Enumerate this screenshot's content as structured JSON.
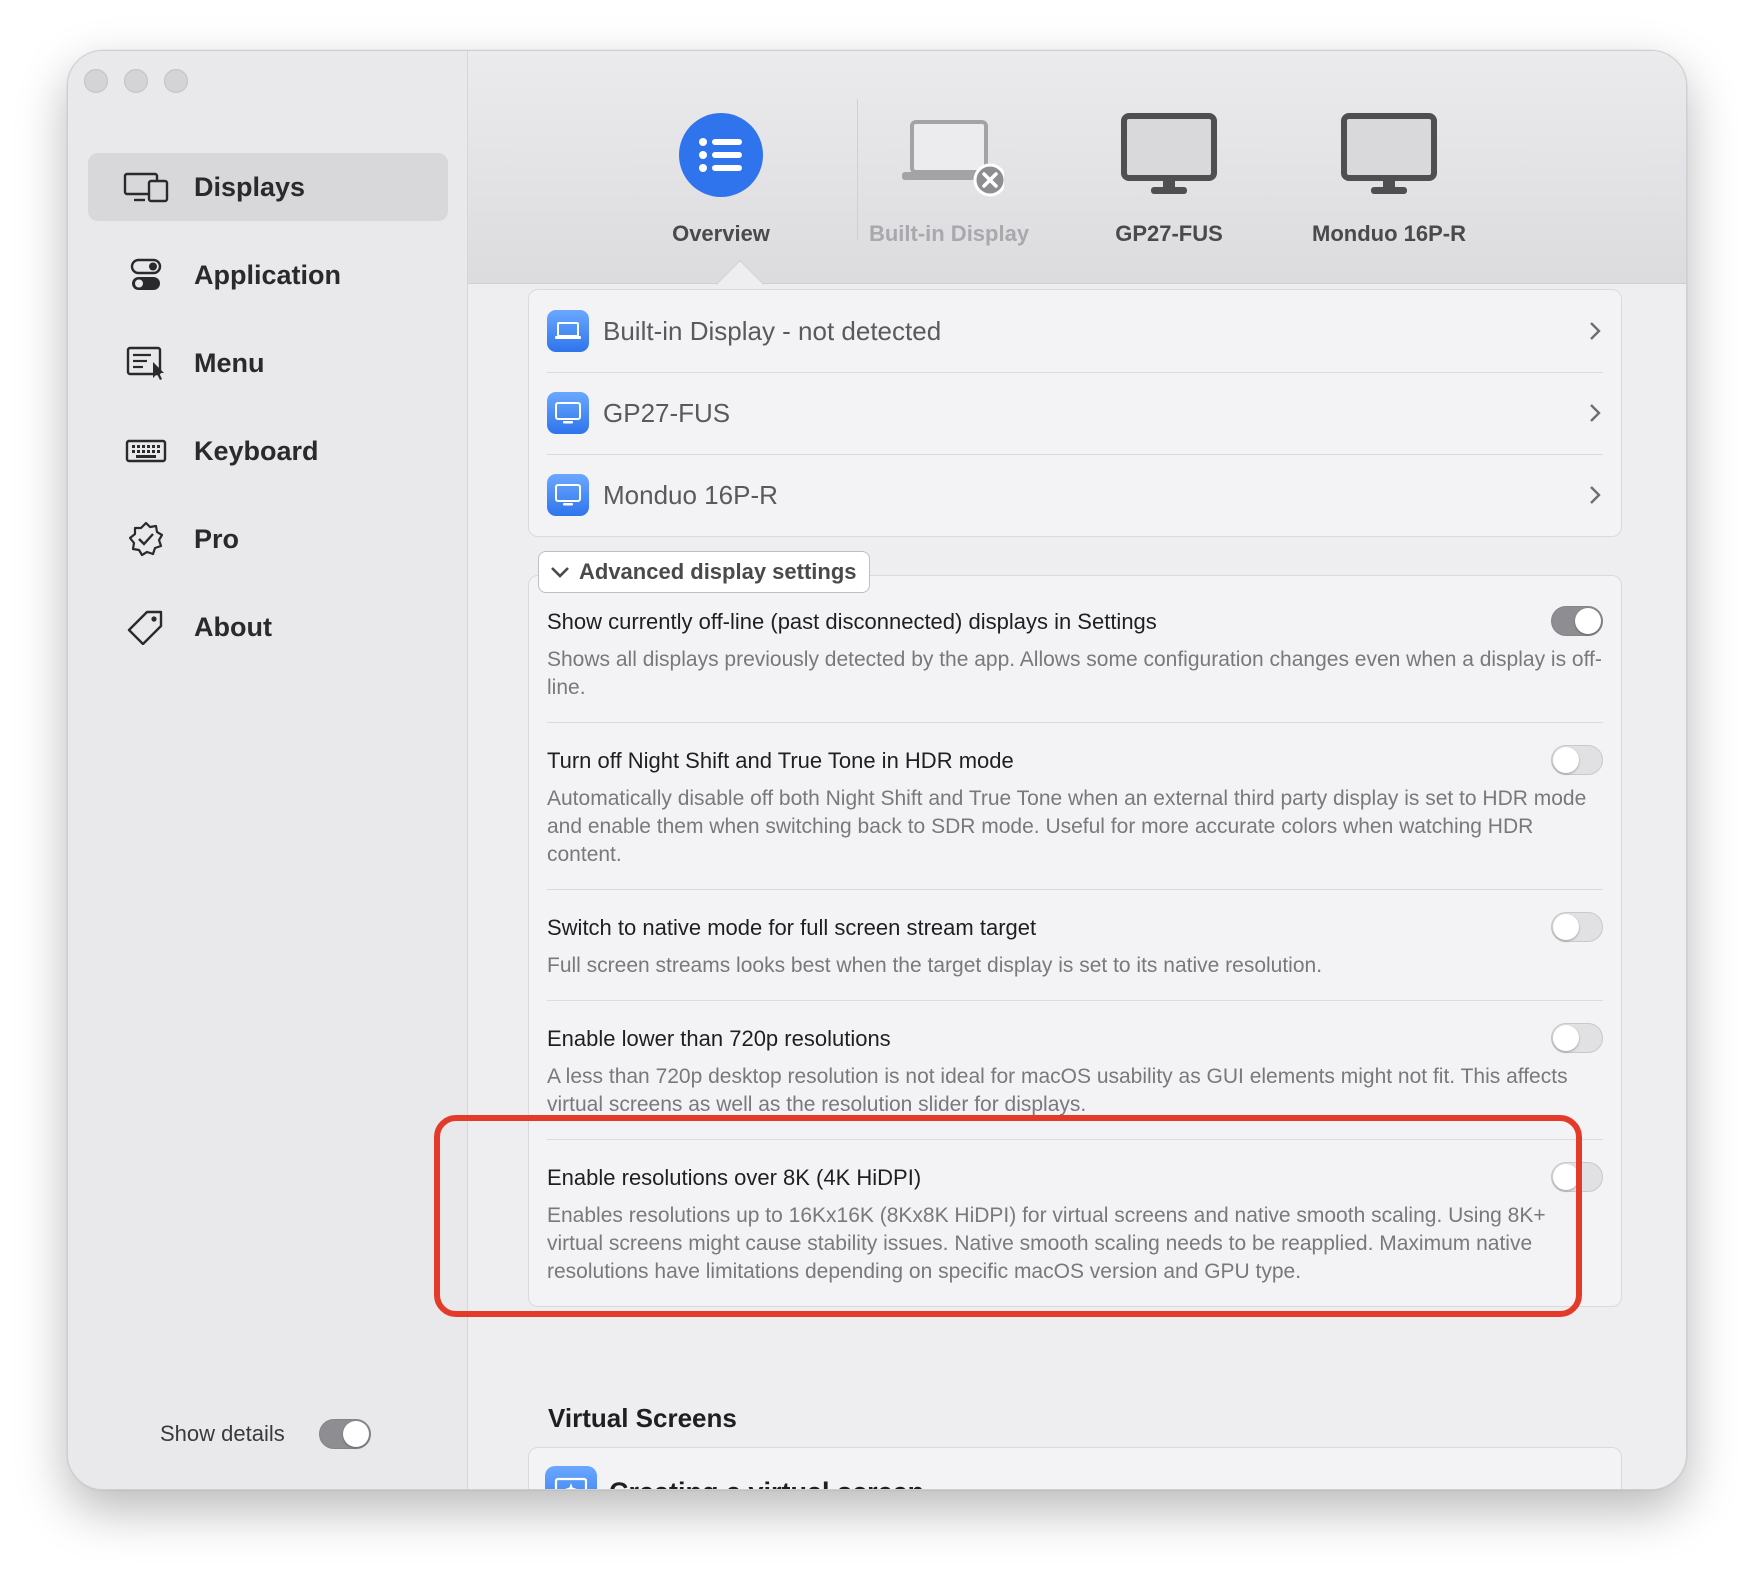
{
  "sidebar": {
    "items": [
      {
        "label": "Displays",
        "icon": "displays-icon",
        "active": true
      },
      {
        "label": "Application",
        "icon": "toggles-icon",
        "active": false
      },
      {
        "label": "Menu",
        "icon": "menu-icon",
        "active": false
      },
      {
        "label": "Keyboard",
        "icon": "keyboard-icon",
        "active": false
      },
      {
        "label": "Pro",
        "icon": "badge-check-icon",
        "active": false
      },
      {
        "label": "About",
        "icon": "tag-icon",
        "active": false
      }
    ],
    "show_details_label": "Show details",
    "show_details_on": true
  },
  "tabs": [
    {
      "label": "Overview",
      "icon": "list-icon",
      "selected": true
    },
    {
      "label": "Built-in Display",
      "icon": "laptop-disconnected-icon",
      "disabled": true
    },
    {
      "label": "GP27-FUS",
      "icon": "monitor-icon"
    },
    {
      "label": "Monduo 16P-R",
      "icon": "monitor-icon"
    }
  ],
  "displays": [
    {
      "label": "Built-in Display - not detected",
      "icon": "laptop-icon"
    },
    {
      "label": "GP27-FUS",
      "icon": "monitor-icon"
    },
    {
      "label": "Monduo 16P-R",
      "icon": "monitor-icon"
    }
  ],
  "advanced": {
    "button_label": "Advanced display settings",
    "settings": [
      {
        "title": "Show currently off-line (past disconnected) displays in Settings",
        "desc": "Shows all displays previously detected by the app. Allows some configuration changes even when a display is off-line.",
        "on": true
      },
      {
        "title": "Turn off Night Shift and True Tone in HDR mode",
        "desc": "Automatically disable off both Night Shift and True Tone when an external third party display is set to HDR mode and enable them when switching back to SDR mode. Useful for more accurate colors when watching HDR content.",
        "on": false
      },
      {
        "title": "Switch to native mode for full screen stream target",
        "desc": "Full screen streams looks best when the target display is set to its native resolution.",
        "on": false
      },
      {
        "title": "Enable lower than 720p resolutions",
        "desc": "A less than 720p desktop resolution is not ideal for macOS usability as GUI elements might not fit. This affects virtual screens as well as the resolution slider for displays.",
        "on": false
      },
      {
        "title": "Enable resolutions over 8K (4K HiDPI)",
        "desc": "Enables resolutions up to 16Kx16K (8Kx8K HiDPI) for virtual screens and native smooth scaling. Using 8K+ virtual screens might cause stability issues. Native smooth scaling needs to be reapplied. Maximum native resolutions have limitations depending on specific macOS version and GPU type.",
        "on": false
      }
    ]
  },
  "virtual_screens": {
    "heading": "Virtual Screens",
    "item_label": "Creating a virtual screen",
    "icon": "virtual-screen-icon"
  },
  "colors": {
    "accent": "#2f74ec",
    "highlight": "#e33a2a"
  }
}
